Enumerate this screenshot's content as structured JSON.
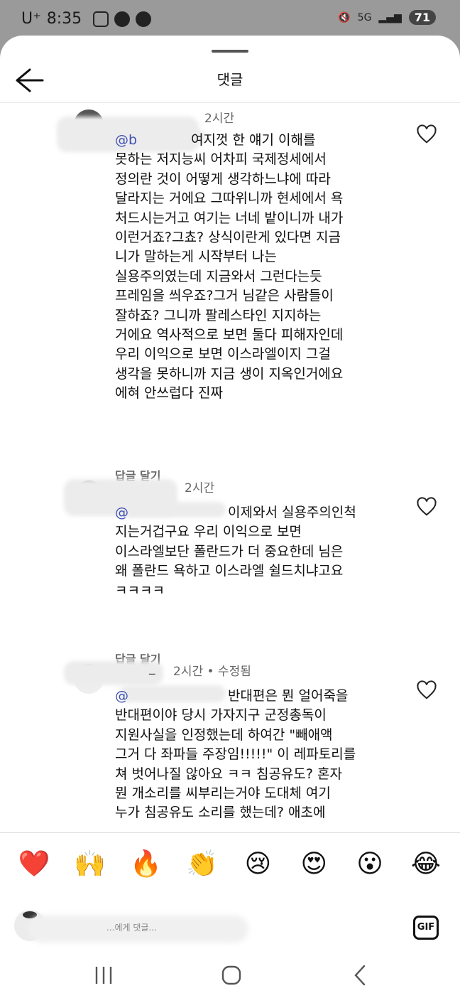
{
  "status": {
    "carrier": "U⁺",
    "time": "8:35",
    "network": "5G",
    "battery": "71"
  },
  "header": {
    "title": "댓글"
  },
  "comments": [
    {
      "username": "",
      "time": "2시간",
      "mention": "@b",
      "text": "여지껏 한 얘기 이해를\n못하는 저지능씨 어차피 국제정세에서\n정의란 것이 어떻게 생각하느냐에 따라\n달라지는 거에요 그따위니까 현세에서 욕\n처드시는거고 여기는 너네 밭이니까 내가\n이런거죠?그쵸? 상식이란게 있다면 지금\n니가 말하는게 시작부터 나는\n실용주의였는데 지금와서 그런다는듯\n프레임을 씌우죠?그거 님같은 사람들이\n잘하죠? 그니까 팔레스타인 지지하는\n거에요 역사적으로 보면 둘다 피해자인데\n우리 이익으로 보면 이스라엘이지 그걸\n생각을 못하니까 지금 생이 지옥인거에요\n에혀 안쓰럽다 진짜",
      "reply": "답글 달기"
    },
    {
      "username": "",
      "time": "2시간",
      "mention": "@",
      "text": "이제와서 실용주의인척\n지는거겁구요 우리 이익으로 보면\n이스라엘보단 폴란드가 더 중요한데 님은\n왜 폴란드 욕하고 이스라엘 쉴드치냐고요\nㅋㅋㅋㅋ",
      "reply": "답글 달기"
    },
    {
      "username": "_",
      "time": "2시간 • 수정됨",
      "mention": "@",
      "text": "반대편은 뭔 얼어죽을\n반대편이야 당시 가자지구 군정총독이\n지원사실을 인정했는데 하여간 \"빼애액\n그거 다 좌파들 주장임!!!!!\" 이 레파토리를\n쳐 벗어나질 않아요 ㅋㅋ 침공유도? 혼자\n뭔 개소리를 씨부리는거야 도대체 여기\n누가 침공유도 소리를 했는데? 애초에",
      "reply": ""
    }
  ],
  "reactions": [
    "❤️",
    "🙌",
    "🔥",
    "👏",
    "😢",
    "😍",
    "😮",
    "😂"
  ],
  "input": {
    "hint": "...에게 댓글..."
  },
  "gif_label": "GIF"
}
